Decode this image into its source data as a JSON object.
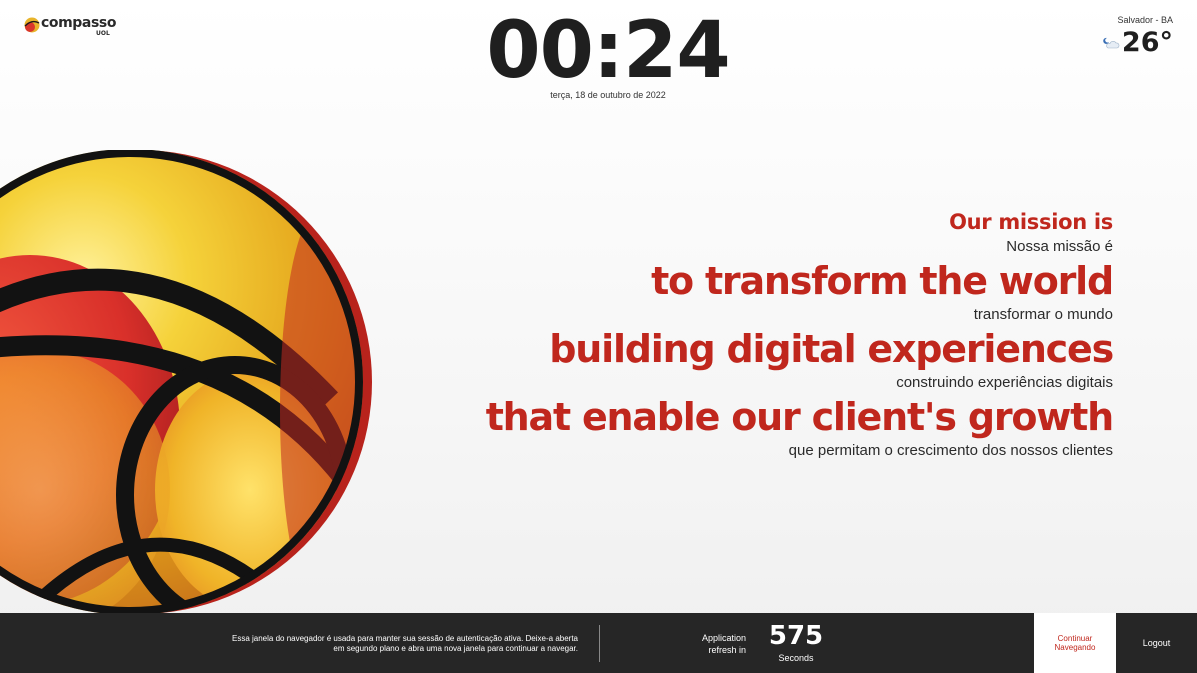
{
  "brand": {
    "name": "compasso",
    "sub": "UOL"
  },
  "clock": {
    "time": "00:24",
    "date": "terça, 18 de outubro de 2022"
  },
  "weather": {
    "city": "Salvador - BA",
    "temperature": "26°",
    "icon": "night-cloud-icon"
  },
  "mission": {
    "lines": [
      {
        "en": "Our mission is",
        "pt": "Nossa missão é"
      },
      {
        "en": "to transform the world",
        "pt": "transformar o mundo"
      },
      {
        "en": "building digital experiences",
        "pt": "construindo experiências digitais"
      },
      {
        "en": "that enable our client's growth",
        "pt": "que permitam o crescimento dos nossos clientes"
      }
    ]
  },
  "footer": {
    "message": "Essa janela do navegador é usada para manter sua sessão de autenticação ativa. Deixe-a aberta em segundo plano e abra uma nova janela para continuar a navegar.",
    "refresh_label": "Application refresh in",
    "countdown": "575",
    "countdown_unit": "Seconds",
    "continue_label": "Continuar Navegando",
    "logout_label": "Logout"
  },
  "colors": {
    "accent": "#c0271d",
    "footer_bg": "#262626",
    "text": "#222222"
  }
}
